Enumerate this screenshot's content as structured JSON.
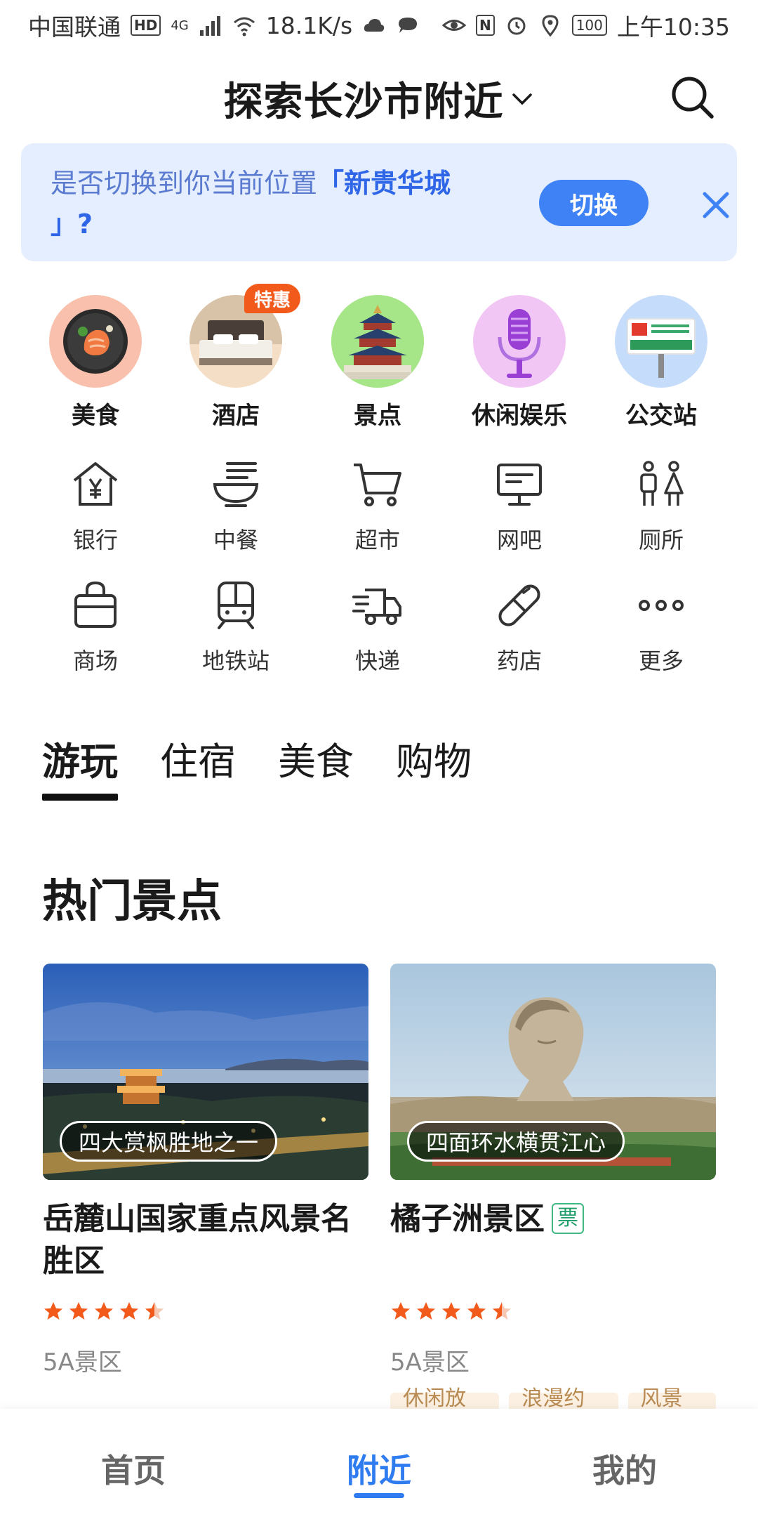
{
  "status_bar": {
    "carrier": "中国联通",
    "hd": "HD",
    "network": "4G",
    "speed": "18.1K/s",
    "nfc": "N",
    "battery": "100",
    "time": "上午10:35"
  },
  "header": {
    "title": "探索长沙市附近"
  },
  "banner": {
    "prompt": "是否切换到你当前位置",
    "location": "「新贵华城",
    "suffix": "」?",
    "switch_label": "切换"
  },
  "featured": [
    {
      "label": "美食",
      "icon": "salmon-plate-icon",
      "bg": "#f9c0ad"
    },
    {
      "label": "酒店",
      "icon": "hotel-bed-icon",
      "bg": "#f4dfc6"
    },
    {
      "label": "景点",
      "icon": "temple-of-heaven-icon",
      "bg": "#9fe37f"
    },
    {
      "label": "休闲娱乐",
      "icon": "microphone-icon",
      "bg": "#f2c6f4"
    },
    {
      "label": "公交站",
      "icon": "bus-stop-sign-icon",
      "bg": "#c6dcfb"
    }
  ],
  "deal_badge": "特惠",
  "grid": [
    [
      {
        "label": "银行",
        "icon": "bank-icon"
      },
      {
        "label": "中餐",
        "icon": "noodle-bowl-icon"
      },
      {
        "label": "超市",
        "icon": "shopping-cart-icon"
      },
      {
        "label": "网吧",
        "icon": "computer-monitor-icon"
      },
      {
        "label": "厕所",
        "icon": "restroom-icon"
      }
    ],
    [
      {
        "label": "商场",
        "icon": "shopping-bag-icon"
      },
      {
        "label": "地铁站",
        "icon": "subway-train-icon"
      },
      {
        "label": "快递",
        "icon": "delivery-truck-icon"
      },
      {
        "label": "药店",
        "icon": "pill-capsule-icon"
      },
      {
        "label": "更多",
        "icon": "more-dots-icon"
      }
    ]
  ],
  "tabs": [
    "游玩",
    "住宿",
    "美食",
    "购物"
  ],
  "active_tab": 0,
  "section": {
    "title": "热门景点"
  },
  "cards": [
    {
      "tag": "四大赏枫胜地之一",
      "title": "岳麓山国家重点风景名胜区",
      "ticket": "",
      "rating": 4.5,
      "category": "5A景区",
      "chips": []
    },
    {
      "tag": "四面环水横贯江心",
      "title": "橘子洲景区",
      "ticket": "票",
      "rating": 4.5,
      "category": "5A景区",
      "chips": [
        "休闲放松",
        "浪漫约会",
        "风景美"
      ]
    }
  ],
  "bottom_nav": {
    "items": [
      "首页",
      "附近",
      "我的"
    ],
    "active": 1
  },
  "colors": {
    "accent": "#2f7bf0",
    "banner_bg": "#e5eefe",
    "star": "#f25a1c",
    "badge": "#f25a1c"
  }
}
